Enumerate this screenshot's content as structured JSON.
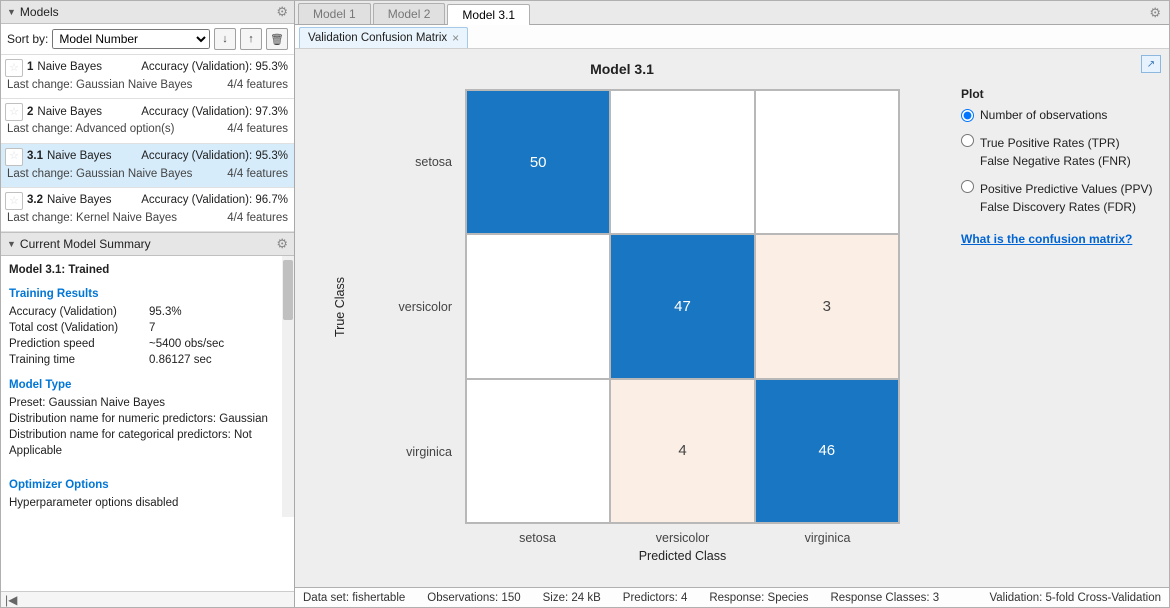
{
  "panels": {
    "models_title": "Models",
    "summary_title": "Current Model Summary",
    "sort_label": "Sort by:",
    "sort_value": "Model Number"
  },
  "models": [
    {
      "idx": "1",
      "name": "Naive Bayes",
      "acc_label": "Accuracy (Validation): 95.3%",
      "change": "Last change: Gaussian Naive Bayes",
      "feat": "4/4 features",
      "selected": false
    },
    {
      "idx": "2",
      "name": "Naive Bayes",
      "acc_label": "Accuracy (Validation): 97.3%",
      "change": "Last change: Advanced option(s)",
      "feat": "4/4 features",
      "selected": false
    },
    {
      "idx": "3.1",
      "name": "Naive Bayes",
      "acc_label": "Accuracy (Validation): 95.3%",
      "change": "Last change: Gaussian Naive Bayes",
      "feat": "4/4 features",
      "selected": true
    },
    {
      "idx": "3.2",
      "name": "Naive Bayes",
      "acc_label": "Accuracy (Validation): 96.7%",
      "change": "Last change: Kernel Naive Bayes",
      "feat": "4/4 features",
      "selected": false
    }
  ],
  "summary": {
    "header_line": "Model 3.1: Trained",
    "training_results_h": "Training Results",
    "metrics": [
      {
        "k": "Accuracy (Validation)",
        "v": "95.3%"
      },
      {
        "k": "Total cost (Validation)",
        "v": "7"
      },
      {
        "k": "Prediction speed",
        "v": "~5400 obs/sec"
      },
      {
        "k": "Training time",
        "v": "0.86127 sec"
      }
    ],
    "model_type_h": "Model Type",
    "model_type_lines": [
      "Preset: Gaussian Naive Bayes",
      "Distribution name for numeric predictors: Gaussian",
      "Distribution name for categorical predictors: Not Applicable"
    ],
    "optimizer_h": "Optimizer Options",
    "optimizer_line": "Hyperparameter options disabled"
  },
  "tabs_main": [
    {
      "label": "Model 1",
      "active": false
    },
    {
      "label": "Model 2",
      "active": false
    },
    {
      "label": "Model 3.1",
      "active": true
    }
  ],
  "tab_sub": "Validation Confusion Matrix",
  "chart": {
    "title": "Model 3.1",
    "ylabel": "True Class",
    "xlabel": "Predicted Class",
    "classes": [
      "setosa",
      "versicolor",
      "virginica"
    ]
  },
  "chart_data": {
    "type": "heatmap",
    "title": "Model 3.1",
    "ylabel": "True Class",
    "xlabel": "Predicted Class",
    "row_labels": [
      "setosa",
      "versicolor",
      "virginica"
    ],
    "col_labels": [
      "setosa",
      "versicolor",
      "virginica"
    ],
    "matrix": [
      [
        50,
        0,
        0
      ],
      [
        0,
        47,
        3
      ],
      [
        0,
        4,
        46
      ]
    ]
  },
  "plot_panel": {
    "title": "Plot",
    "opt1": "Number of observations",
    "opt2a": "True Positive Rates (TPR)",
    "opt2b": "False Negative Rates (FNR)",
    "opt3a": "Positive Predictive Values (PPV)",
    "opt3b": "False Discovery Rates (FDR)",
    "link": "What is the confusion matrix?"
  },
  "status": {
    "dataset": "Data set: fishertable",
    "obs": "Observations: 150",
    "size": "Size: 24 kB",
    "pred": "Predictors: 4",
    "resp": "Response: Species",
    "respcls": "Response Classes: 3",
    "valid": "Validation: 5-fold Cross-Validation"
  }
}
